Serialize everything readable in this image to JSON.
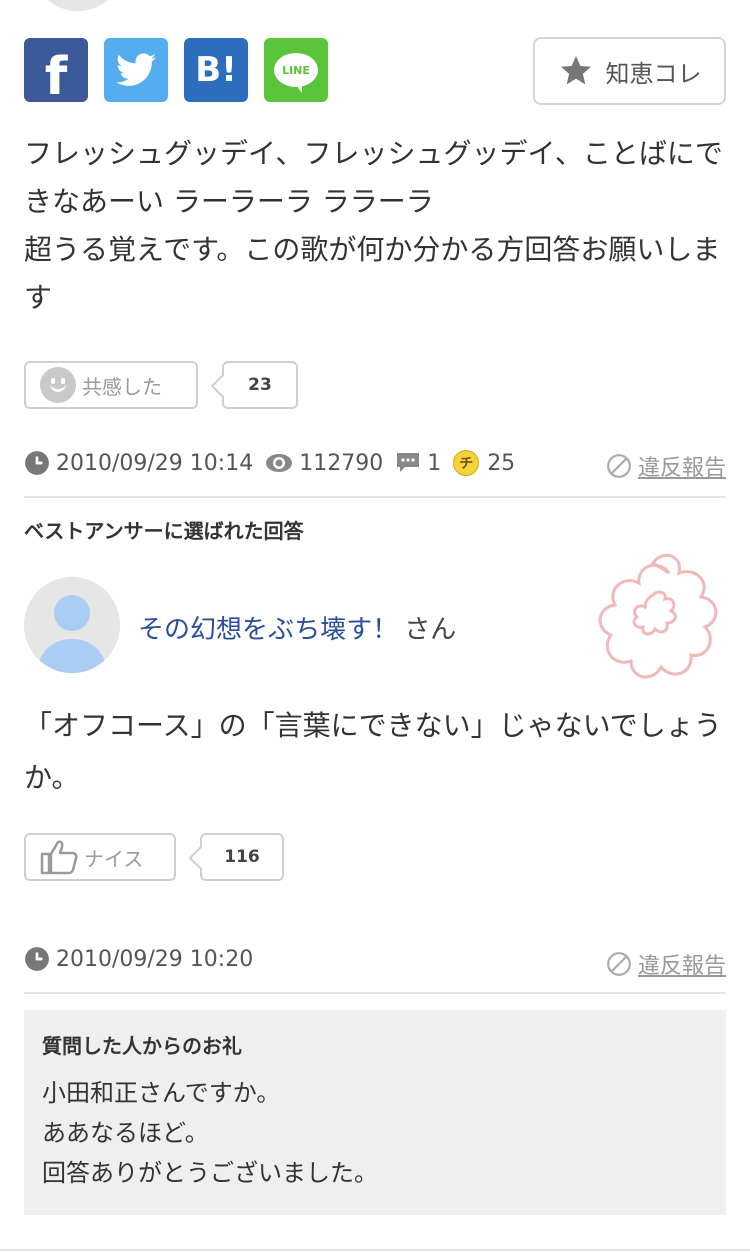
{
  "share": {
    "facebook_label": "f",
    "hatena_label": "B!",
    "line_label": "LINE",
    "facebook_color": "#3b5998",
    "twitter_color": "#55acee",
    "hatena_color": "#2c6ebd",
    "line_color": "#5ac53a"
  },
  "chie_button": {
    "label": "知恵コレ",
    "icon": "star-icon"
  },
  "question": {
    "text": "フレッシュグッデイ、フレッシュグッデイ、ことばにできなあーい ラーラーラ ララーラ\n超うる覚えです。この歌が何か分かる方回答お願いします",
    "empathy_label": "共感した",
    "empathy_count": "23",
    "datetime": "2010/09/29 10:14",
    "views": "112790",
    "answers": "1",
    "coin_label": "チ",
    "coins": "25",
    "report_label": "違反報告"
  },
  "best_answer": {
    "heading": "ベストアンサーに選ばれた回答",
    "user_name": "その幻想をぶち壊す！",
    "user_suffix": "さん",
    "text": "「オフコース」の「言葉にできない」じゃないでしょうか。",
    "nice_label": "ナイス",
    "nice_count": "116",
    "datetime": "2010/09/29 10:20",
    "report_label": "違反報告"
  },
  "thanks": {
    "title": "質問した人からのお礼",
    "text": "小田和正さんですか。\nああなるほど。\n回答ありがとうございました。"
  }
}
